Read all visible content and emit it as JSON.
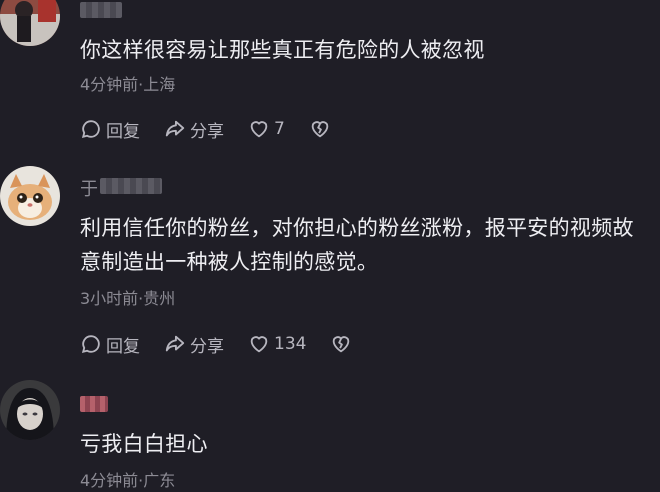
{
  "comments": [
    {
      "text": "你这样很容易让那些真正有危险的人被忽视",
      "meta": "4分钟前·上海",
      "reply_label": "回复",
      "share_label": "分享",
      "like_count": "7"
    },
    {
      "username_visible": "于",
      "text": "利用信任你的粉丝，对你担心的粉丝涨粉，报平安的视频故意制造出一种被人控制的感觉。",
      "meta": "3小时前·贵州",
      "reply_label": "回复",
      "share_label": "分享",
      "like_count": "134"
    },
    {
      "text": "亏我白白担心",
      "meta": "4分钟前·广东"
    }
  ],
  "icons": {
    "reply": "comment-bubble-icon",
    "share": "share-arrow-icon",
    "like": "heart-icon",
    "dislike": "broken-heart-icon"
  },
  "colors": {
    "background": "#1f1e26",
    "text": "#eeeef2",
    "meta": "#8c8b94",
    "action": "#b7b6bf"
  }
}
